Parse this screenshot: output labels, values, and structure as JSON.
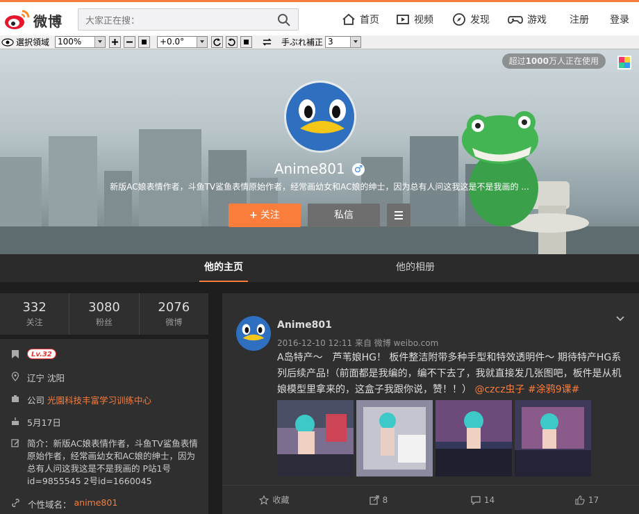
{
  "topbar": {
    "logo_text": "微博",
    "search_placeholder": "大家正在搜：",
    "nav": [
      {
        "label": "首页",
        "icon": "home-icon"
      },
      {
        "label": "视频",
        "icon": "video-icon"
      },
      {
        "label": "发现",
        "icon": "compass-icon"
      },
      {
        "label": "游戏",
        "icon": "gamepad-icon"
      }
    ],
    "register": "注册",
    "login": "登录"
  },
  "toolbar": {
    "select_area": "選択領域",
    "zoom": "100%",
    "rotation": "+0.0°",
    "stabilize_label": "手ぶれ補正",
    "stabilize_value": "3"
  },
  "cover": {
    "badge_prefix": "超过",
    "badge_strong": "1000",
    "badge_suffix": "万人正在使用",
    "nickname": "Anime801",
    "gender": "♂",
    "description": "新版AC娘表情作者，斗鱼TV鲨鱼表情原始作者，经常画幼女和AC娘的绅士，因为总有人问这我这是不是我画的 ...",
    "follow_label": "关注",
    "message_label": "私信"
  },
  "tabs": [
    {
      "label": "他的主页",
      "active": true
    },
    {
      "label": "他的相册",
      "active": false
    }
  ],
  "stats": [
    {
      "num": "332",
      "label": "关注"
    },
    {
      "num": "3080",
      "label": "粉丝"
    },
    {
      "num": "2076",
      "label": "微博"
    }
  ],
  "info": {
    "level": "Lv.32",
    "location": "辽宁 沈阳",
    "company_prefix": "公司",
    "company": "光園科技丰富学习训练中心",
    "birthday": "5月17日",
    "bio_l1": "简介：新版AC娘表情作者，斗鱼TV鲨鱼表情",
    "bio_l2": "原始作者，经常画幼女和AC娘的绅士，因为",
    "bio_l3": "总有人问这我这是不是我画的 P站1号",
    "bio_l4": "id=9855545 2号id=1660045",
    "domain_label": "个性域名：",
    "domain": "anime801"
  },
  "feed": {
    "user": "Anime801",
    "time": "2016-12-10 12:11 来自 微博 weibo.com",
    "text_main": "A岛特产～　芦苇娘HG！ 板件整洁附带多种手型和特效透明件～ 期待特产HG系列后续产品!（前面都是我编的，编不下去了，我就直接发几张图吧，板件是从机娘模型里拿来的，这盒子我跟你说，赞！！）",
    "mention": "@czcz虫子",
    "hashtag": "#涂鸦9课#",
    "actions": [
      {
        "label": "收藏",
        "icon": "star-icon"
      },
      {
        "label": "8",
        "icon": "repost-icon"
      },
      {
        "label": "14",
        "icon": "comment-icon"
      },
      {
        "label": "17",
        "icon": "like-icon"
      }
    ]
  },
  "colors": {
    "accent": "#fa7d3c",
    "dark_bg": "#1e1e1e",
    "card_bg": "#2f2f2f"
  }
}
